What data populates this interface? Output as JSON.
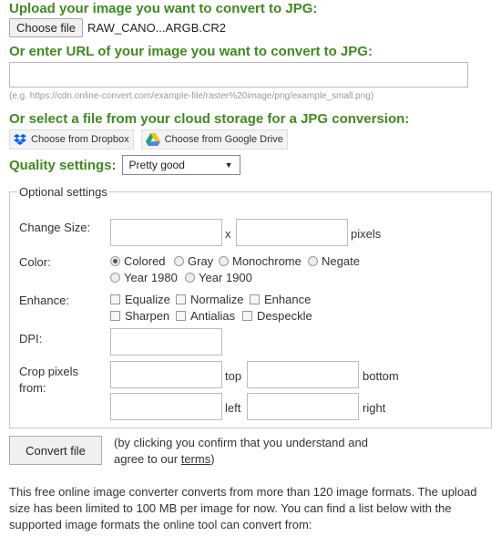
{
  "upload": {
    "heading": "Upload your image you want to convert to JPG:",
    "choose_file_label": "Choose file",
    "file_name": "RAW_CANO...ARGB.CR2"
  },
  "url": {
    "heading": "Or enter URL of your image you want to convert to JPG:",
    "value": "",
    "hint": "(e.g. https://cdn.online-convert.com/example-file/raster%20image/png/example_small.png)"
  },
  "cloud": {
    "heading": "Or select a file from your cloud storage for a JPG conversion:",
    "dropbox_label": "Choose from Dropbox",
    "gdrive_label": "Choose from Google Drive"
  },
  "quality": {
    "label": "Quality settings:",
    "selected": "Pretty good"
  },
  "optional": {
    "legend": "Optional settings",
    "change_size_label": "Change Size:",
    "size_separator": "x",
    "size_unit": "pixels",
    "color_label": "Color:",
    "color_options": [
      {
        "label": "Colored",
        "checked": true
      },
      {
        "label": "Gray",
        "checked": false
      },
      {
        "label": "Monochrome",
        "checked": false
      },
      {
        "label": "Negate",
        "checked": false
      },
      {
        "label": "Year 1980",
        "checked": false
      },
      {
        "label": "Year 1900",
        "checked": false
      }
    ],
    "enhance_label": "Enhance:",
    "enhance_options": [
      {
        "label": "Equalize",
        "checked": false
      },
      {
        "label": "Normalize",
        "checked": false
      },
      {
        "label": "Enhance",
        "checked": false
      },
      {
        "label": "Sharpen",
        "checked": false
      },
      {
        "label": "Antialias",
        "checked": false
      },
      {
        "label": "Despeckle",
        "checked": false
      }
    ],
    "dpi_label": "DPI:",
    "crop_label_1": "Crop pixels",
    "crop_label_2": "from:",
    "crop_top": "top",
    "crop_bottom": "bottom",
    "crop_left": "left",
    "crop_right": "right"
  },
  "convert": {
    "button_label": "Convert file",
    "confirm_line1": "(by clicking you confirm that you understand and",
    "confirm_line2_prefix": "agree to our ",
    "terms_link": "terms",
    "confirm_line2_suffix": ")"
  },
  "info": {
    "text": "This free online image converter converts from more than 120 image formats. The upload size has been limited to 100 MB per image for now. You can find a list below with the supported image formats the online tool can convert from:"
  },
  "colors": {
    "heading_green": "#3f8a1e",
    "dropbox_blue": "#0061fe"
  }
}
